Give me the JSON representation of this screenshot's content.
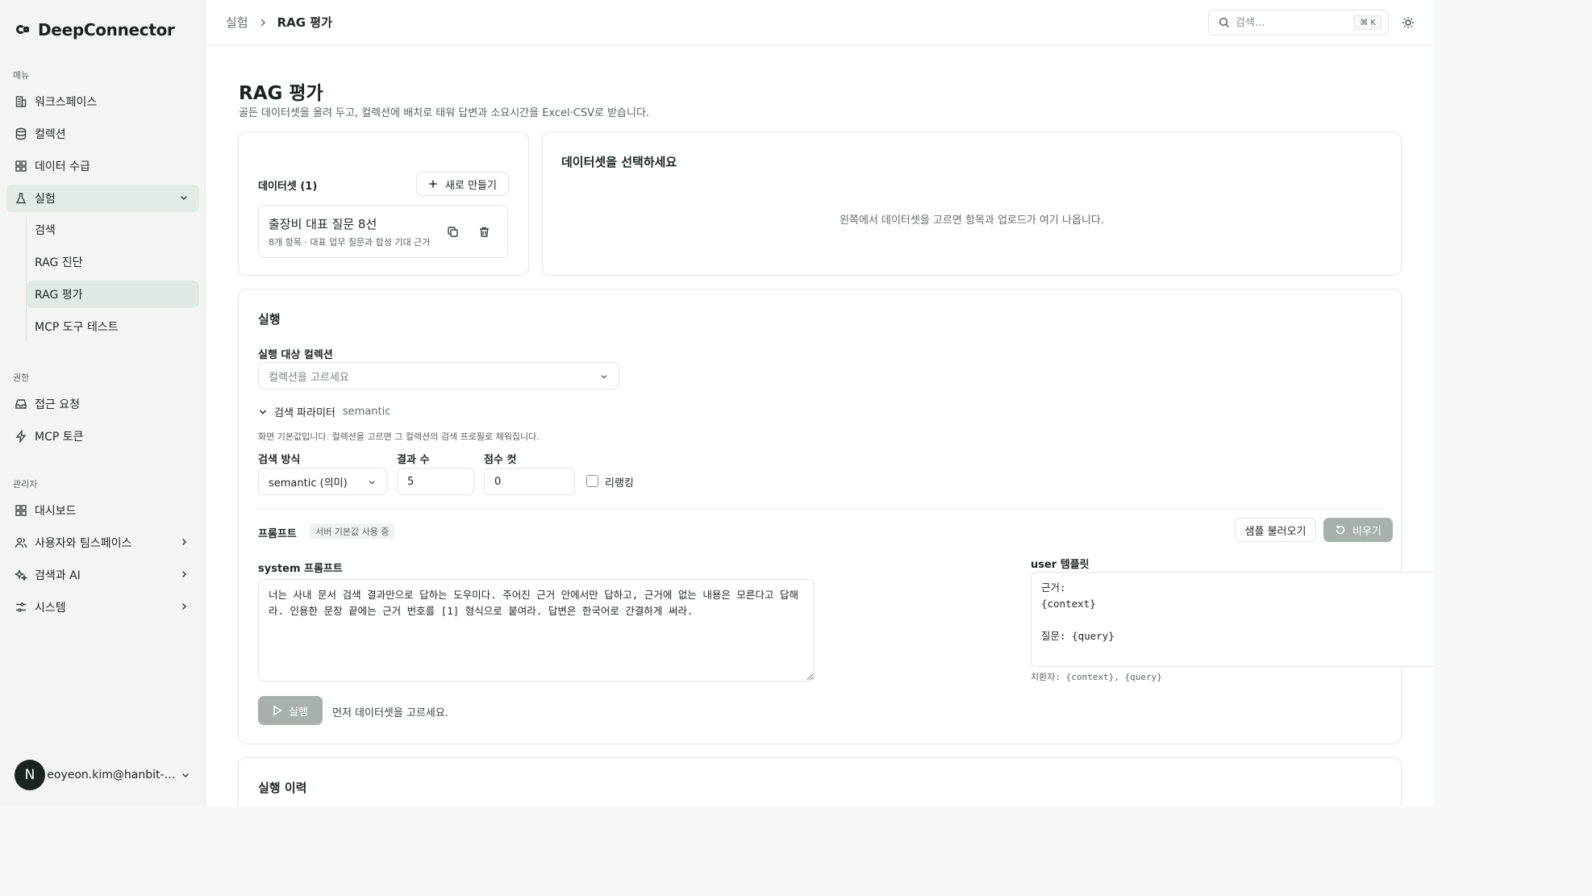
{
  "app": {
    "name": "DeepConnector"
  },
  "sidebar": {
    "menu_label": "메뉴",
    "menu_items": [
      {
        "label": "워크스페이스",
        "icon": "building-icon"
      },
      {
        "label": "컬렉션",
        "icon": "database-icon"
      },
      {
        "label": "데이터 수급",
        "icon": "grid-icon"
      },
      {
        "label": "실험",
        "icon": "flask-icon"
      }
    ],
    "experiment_sub": [
      {
        "label": "검색"
      },
      {
        "label": "RAG 진단"
      },
      {
        "label": "RAG 평가"
      },
      {
        "label": "MCP 도구 테스트"
      }
    ],
    "permission_label": "권한",
    "permission_items": [
      {
        "label": "접근 요청",
        "icon": "inbox-icon"
      },
      {
        "label": "MCP 토큰",
        "icon": "bolt-icon"
      }
    ],
    "admin_label": "관리자",
    "admin_items": [
      {
        "label": "대시보드",
        "icon": "grid-icon"
      },
      {
        "label": "사용자와 팀스페이스",
        "icon": "users-icon"
      },
      {
        "label": "검색과 AI",
        "icon": "sparkle-icon"
      },
      {
        "label": "시스템",
        "icon": "sliders-icon"
      }
    ],
    "user": {
      "initial": "N",
      "email": "seoyeon.kim@hanbit-de..."
    }
  },
  "topbar": {
    "breadcrumb": [
      "실험",
      "RAG 평가"
    ],
    "search_placeholder": "검색...",
    "search_shortcut": "⌘ K"
  },
  "page": {
    "title": "RAG 평가",
    "description": "골든 데이터셋을 올려 두고, 컬렉션에 배치로 태워 답변과 소요시간을 Excel·CSV로 받습니다."
  },
  "datasets": {
    "title": "데이터셋 (1)",
    "new_button": "새로 만들기",
    "items": [
      {
        "name": "출장비 대표 질문 8선",
        "meta": "8개 항목 · 대표 업무 질문과 합성 기대 근거"
      }
    ]
  },
  "detail": {
    "title": "데이터셋을 선택하세요",
    "empty_message": "왼쪽에서 데이터셋을 고르면 항목과 업로드가 여기 나옵니다."
  },
  "run": {
    "title": "실행",
    "collection_label": "실행 대상 컬렉션",
    "collection_placeholder": "컬렉션을 고르세요",
    "params_label": "검색 파라미터",
    "params_mode": "semantic",
    "params_note": "화면 기본값입니다. 컬렉션을 고르면 그 컬렉션의 검색 프로필로 채워집니다.",
    "method_label": "검색 방식",
    "method_value": "semantic (의미)",
    "topk_label": "결과 수",
    "topk_value": "5",
    "cutoff_label": "점수 컷",
    "cutoff_value": "0",
    "rerank_label": "리랭킹",
    "rerank_checked": false,
    "prompt_label": "프롬프트",
    "prompt_badge": "서버 기본값 사용 중",
    "sample_button": "샘플 불러오기",
    "clear_button": "비우기",
    "system_label": "system 프롬프트",
    "system_value": "너는 사내 문서 검색 결과만으로 답하는 도우미다. 주어진 근거 안에서만 답하고, 근거에 없는 내용은 모른다고 답해라. 인용한 문장 끝에는 근거 번호를 [1] 형식으로 붙여라. 답변은 한국어로 간결하게 써라.",
    "user_label": "user 템플릿",
    "user_value": "근거:\n{context}\n\n질문: {query}",
    "placeholder_hint": "치환자: {context}, {query}",
    "run_button": "실행",
    "run_hint": "먼저 데이터셋을 고르세요."
  },
  "history": {
    "title": "실행 이력"
  }
}
